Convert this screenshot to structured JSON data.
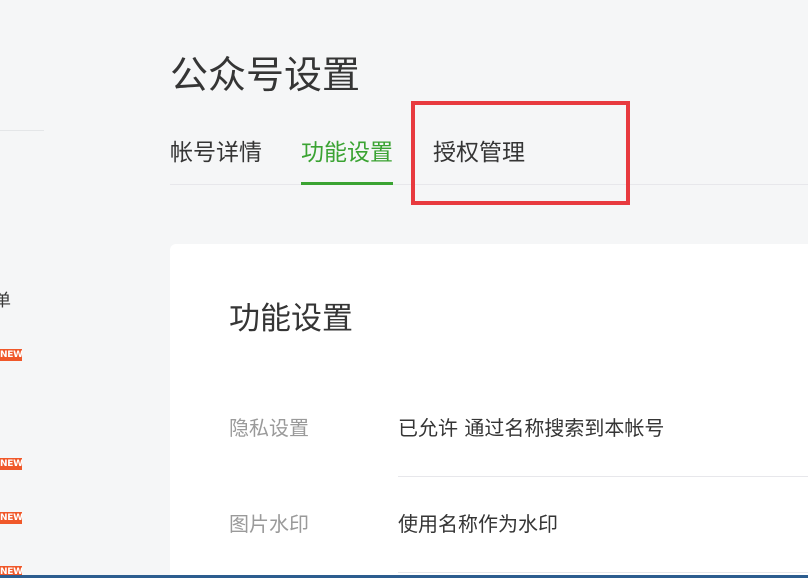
{
  "sidebar": {
    "partial_item_text": "单",
    "badges": [
      "NEW",
      "NEW",
      "NEW",
      "NEW"
    ]
  },
  "header": {
    "title": "公众号设置"
  },
  "tabs": [
    {
      "label": "帐号详情",
      "active": false
    },
    {
      "label": "功能设置",
      "active": true
    },
    {
      "label": "授权管理",
      "active": false,
      "highlighted": true
    }
  ],
  "card": {
    "title": "功能设置",
    "settings": [
      {
        "label": "隐私设置",
        "value": "已允许 通过名称搜索到本帐号"
      },
      {
        "label": "图片水印",
        "value": "使用名称作为水印"
      }
    ]
  },
  "colors": {
    "accent_green": "#3aa332",
    "highlight_red": "#e83a3f",
    "badge_orange": "#f0582a"
  }
}
